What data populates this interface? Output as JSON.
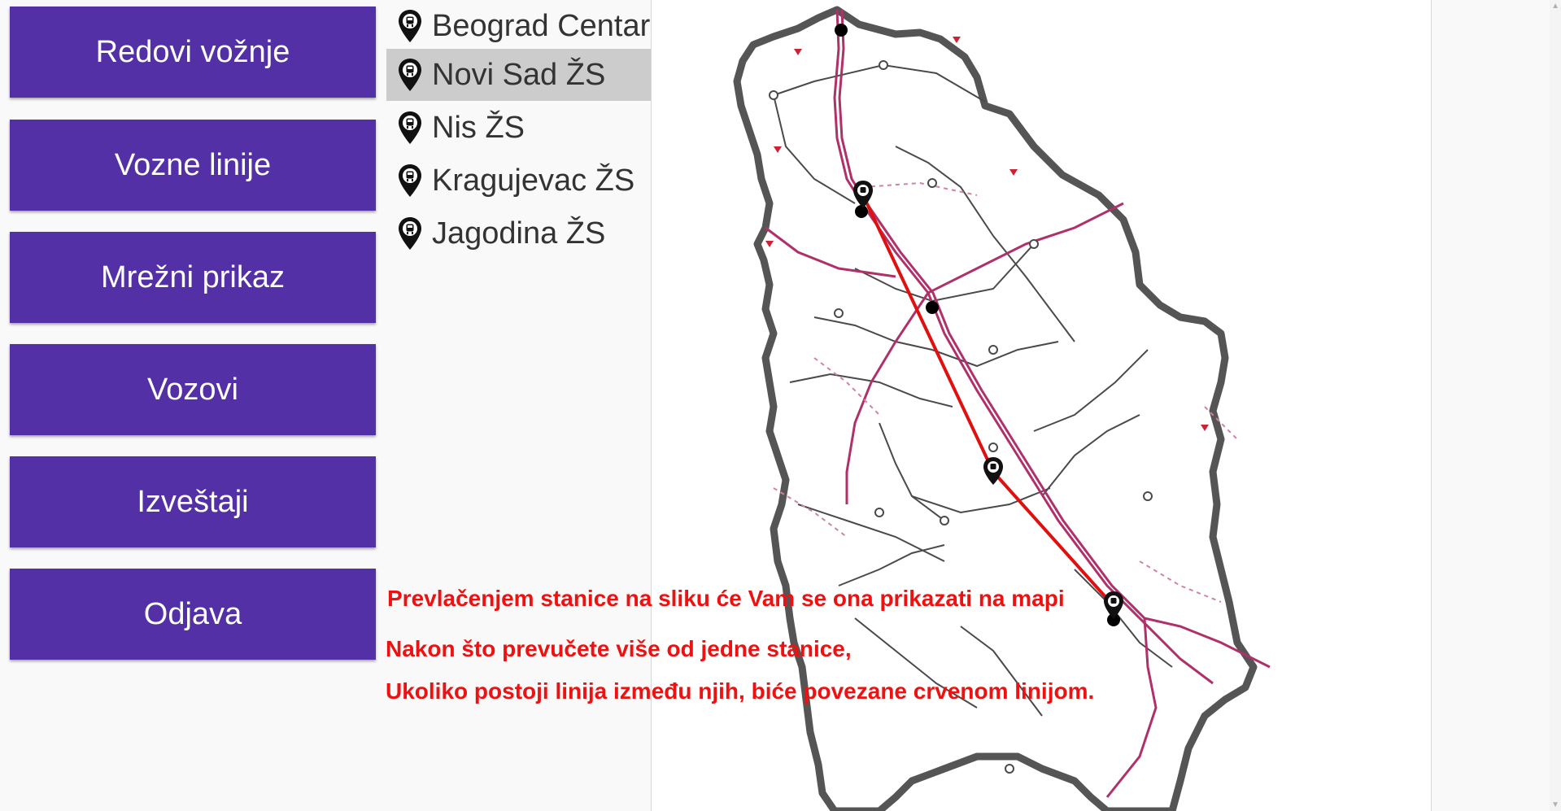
{
  "nav": {
    "items": [
      {
        "label": "Redovi vožnje"
      },
      {
        "label": "Vozne linije"
      },
      {
        "label": "Mrežni prikaz"
      },
      {
        "label": "Vozovi"
      },
      {
        "label": "Izveštaji"
      },
      {
        "label": "Odjava"
      }
    ]
  },
  "stations": {
    "icon": "map-pin-train-icon",
    "selected_index": 1,
    "items": [
      {
        "name": "Beograd Centar"
      },
      {
        "name": "Novi Sad ŽS"
      },
      {
        "name": "Nis ŽS"
      },
      {
        "name": "Kragujevac ŽS"
      },
      {
        "name": "Jagodina ŽS"
      }
    ]
  },
  "help": {
    "line1": "Prevlačenjem stanice na sliku će Vam se ona prikazati na mapi",
    "line2": "Nakon što prevučete više od jedne stanice,",
    "line3": "Ukoliko postoji linija između njih, biće povezane crvenom linijom."
  },
  "colors": {
    "nav_button": "#5330a5",
    "nav_text": "#ffffff",
    "selected_station": "#cccccc",
    "help_text": "#ee1111",
    "connection_line": "#e01010",
    "railway": "#b0306a",
    "border": "#555555"
  }
}
